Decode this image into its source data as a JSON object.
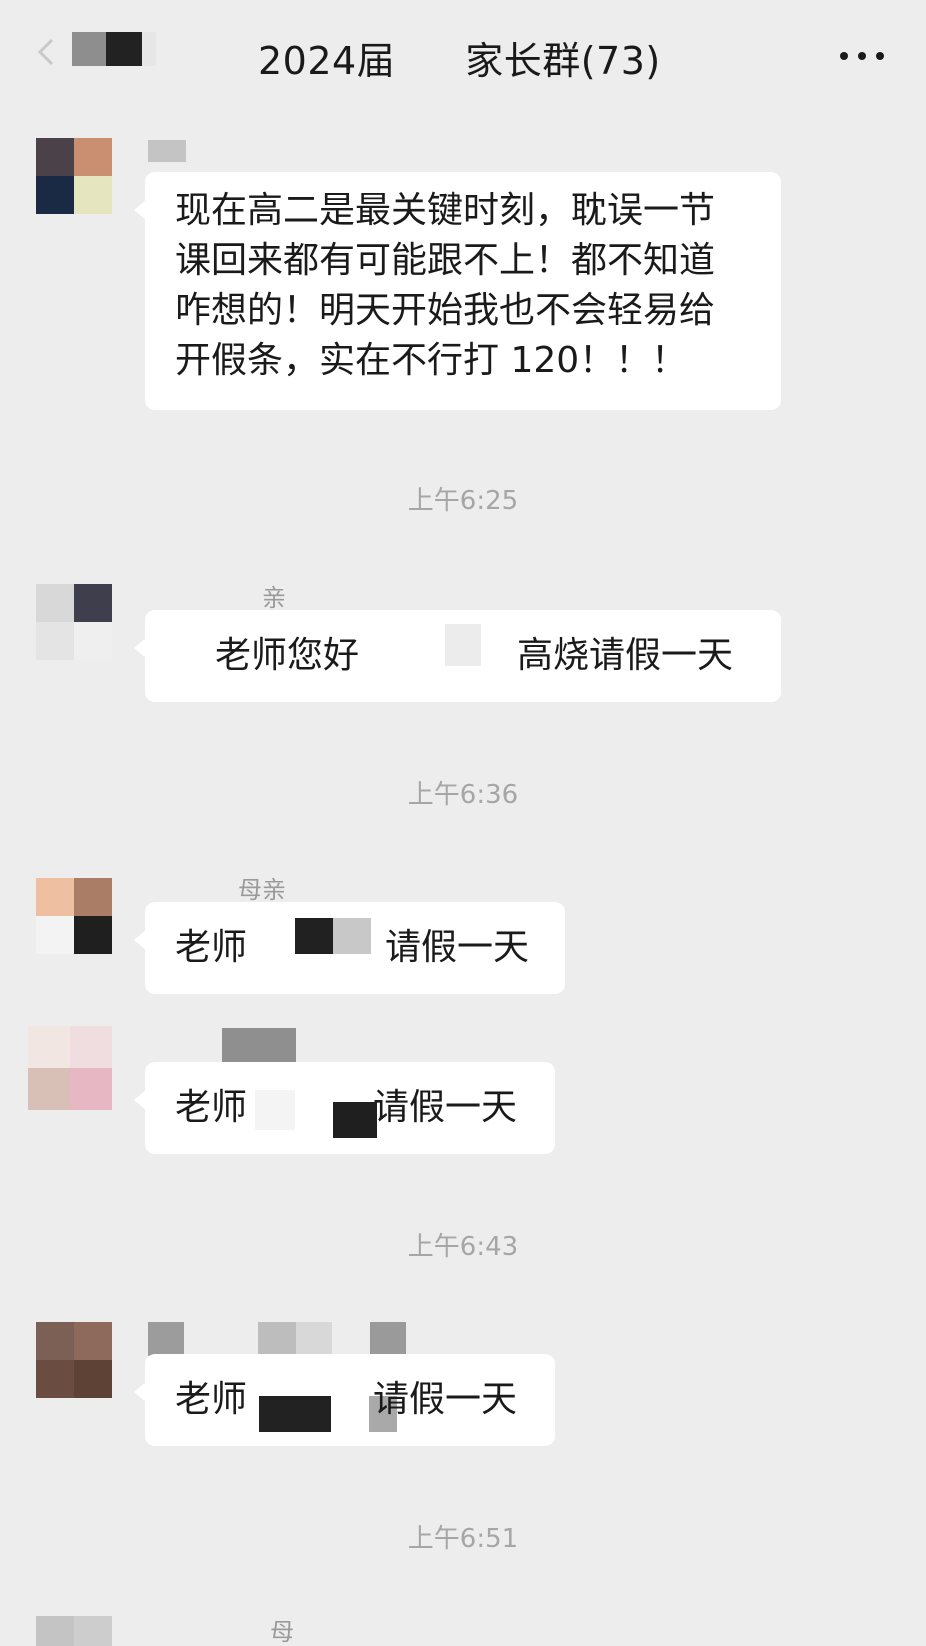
{
  "header": {
    "back_label": "",
    "title_prefix": "2024届",
    "title_suffix": "家长群(73)"
  },
  "messages": [
    {
      "sender": "",
      "lines": [
        "现在高二是最关键时刻，耽误一节",
        "课回来都有可能跟不上！都不知道",
        "咋想的！明天开始我也不会轻易给",
        "开假条，实在不行打 120！！！"
      ]
    },
    {
      "timestamp": "上午6:25"
    },
    {
      "sender": "亲",
      "text_left": "老师您好",
      "text_right": "高烧请假一天"
    },
    {
      "timestamp": "上午6:36"
    },
    {
      "sender": "母亲",
      "text_left": "老师",
      "text_right": "请假一天"
    },
    {
      "sender": "",
      "text_left": "老师",
      "text_right": "请假一天"
    },
    {
      "timestamp": "上午6:43"
    },
    {
      "sender": "",
      "text_left": "老师",
      "text_right": "请假一天"
    },
    {
      "timestamp": "上午6:51"
    },
    {
      "sender": "母"
    }
  ],
  "colors": {
    "background": "#ededed",
    "bubble": "#ffffff",
    "text": "#1a1a1a",
    "timestamp": "#a6a6a6"
  },
  "icons": {
    "back": "chevron-left-icon",
    "more": "more-dots-icon"
  }
}
